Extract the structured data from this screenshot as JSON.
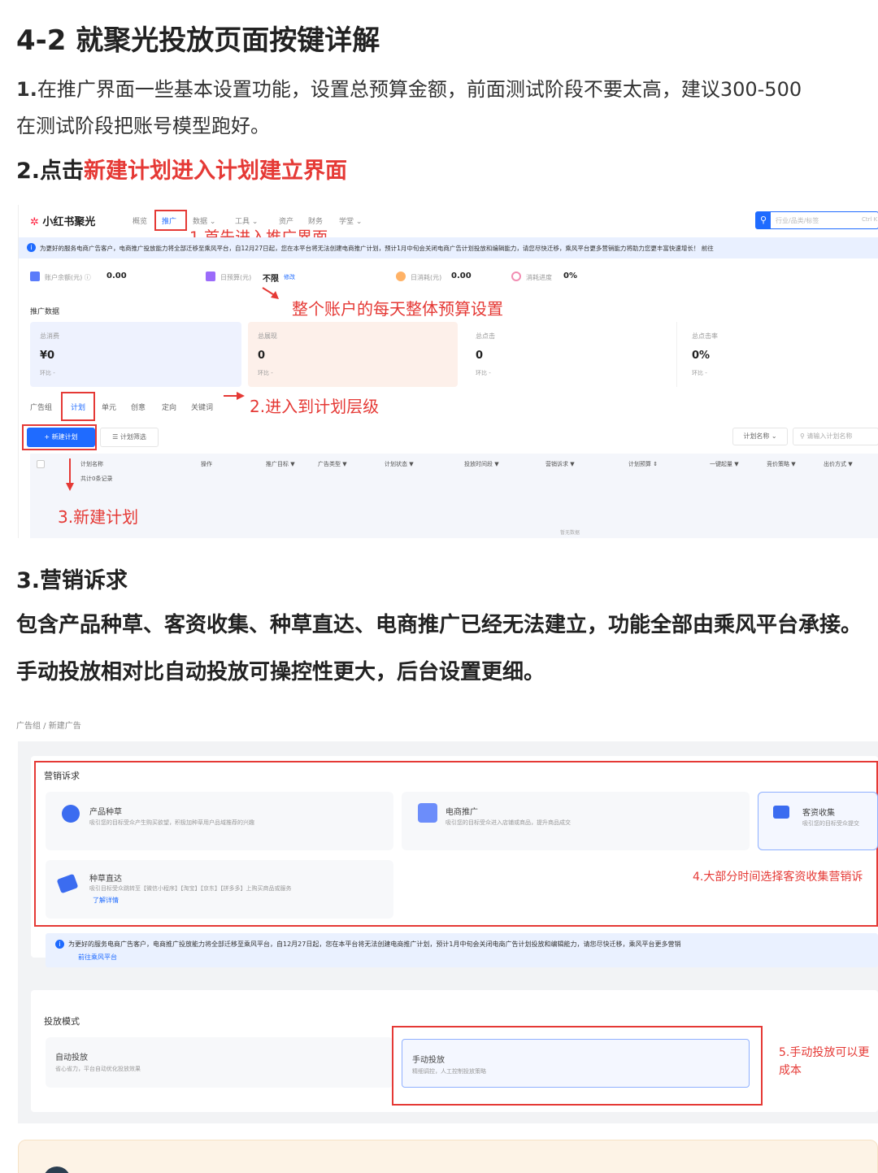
{
  "article": {
    "title": "4-2 就聚光投放页面按键详解",
    "p1_num": "1.",
    "p1_line1": "在推广界面一些基本设置功能，设置总预算金额，前面测试阶段不要太高，建议300-500",
    "p1_line2": "在测试阶段把账号模型跑好。",
    "s2_prefix": "2.点击",
    "s2_red": "新建计划进入计划建立界面",
    "s3_title": "3.营销诉求",
    "s3_red": "包含产品种草、客资收集、种草直达、电商推广已经无法建立，功能全部由乘风平台承接。",
    "s3_blue": "手动投放相对比自动投放可操控性更大，后台设置更细。"
  },
  "shot1": {
    "logo": "小红书聚光",
    "nav": [
      "概览",
      "推广",
      "数据 ⌄",
      "工具 ⌄",
      "资产",
      "财务",
      "学堂 ⌄"
    ],
    "search_placeholder": "行业/品类/标签",
    "search_shortcut": "Ctrl K",
    "notice": "为更好的服务电商广告客户，电商推广投放能力将全部迁移至乘风平台，自12月27日起，您在本平台将无法创建电商推广计划，预计1月中旬会关闭电商广告计划投放和编辑能力，请您尽快迁移，乘风平台更多营销能力将助力您更丰富快速增长！ 前往",
    "stats": [
      {
        "label": "账户余额(元) ⓘ",
        "value": "0.00"
      },
      {
        "label": "日预算(元)",
        "value": "不限",
        "link": "修改"
      },
      {
        "label": "日消耗(元)",
        "value": "0.00"
      },
      {
        "label": "消耗进度",
        "value": "0%"
      }
    ],
    "section": "推广数据",
    "cards": [
      {
        "label": "总消费",
        "value": "¥0",
        "sub": "环比 -"
      },
      {
        "label": "总展现",
        "value": "0",
        "sub": "环比 -"
      },
      {
        "label": "总点击",
        "value": "0",
        "sub": "环比 -"
      },
      {
        "label": "总点击率",
        "value": "0%",
        "sub": "环比 -"
      }
    ],
    "tabs": [
      "广告组",
      "计划",
      "单元",
      "创意",
      "定向",
      "关键词"
    ],
    "new_plan": "+ 新建计划",
    "filter": "☰ 计划筛选",
    "plan_name_select": "计划名称 ⌄",
    "plan_search": "请输入计划名称",
    "columns": [
      "计划名称",
      "操作",
      "推广目标 ▼",
      "广告类型 ▼",
      "计划状态 ▼",
      "投放时间段 ▼",
      "营销诉求 ▼",
      "计划预算 ⇕",
      "一键起量 ▼",
      "竞价策略 ▼",
      "出价方式 ▼"
    ],
    "row_sub": "共计0条记录",
    "empty": "暂无数据",
    "ann1": "1.首先进入推广界面",
    "ann2": "整个账户的每天整体预算设置",
    "ann3": "2.进入到计划层级",
    "ann4": "3.新建计划"
  },
  "shot2": {
    "breadcrumb": "广告组 / 新建广告",
    "marketing_title": "营销诉求",
    "options": [
      {
        "title": "产品种草",
        "desc": "吸引您的目标受众产生购买欲望，积极加种草用户品域推荐的兴趣"
      },
      {
        "title": "电商推广",
        "desc": "吸引您的目标受众进入店铺或商品，提升商品成交"
      },
      {
        "title": "客资收集",
        "desc": "吸引您的目标受众提交"
      },
      {
        "title": "种草直达",
        "desc": "吸引目标受众跳转至【微信小程序】【淘宝】【京东】【拼多多】上购买商品或服务",
        "link": "了解详情"
      }
    ],
    "ann5": "4.大部分时间选择客资收集营销诉",
    "notice": "为更好的服务电商广告客户，电商推广投放能力将全部迁移至乘风平台，自12月27日起，您在本平台将无法创建电商推广计划，预计1月中旬会关闭电商广告计划投放和编辑能力，请您尽快迁移，乘风平台更多营销",
    "notice_link": "前往乘风平台",
    "mode_title": "投放模式",
    "modes": [
      {
        "title": "自动投放",
        "desc": "省心省力，平台自动优化投放效果"
      },
      {
        "title": "手动投放",
        "desc": "精细调控，人工控制投放策略"
      }
    ],
    "ann6_l1": "5.手动投放可以更",
    "ann6_l2": "成本"
  },
  "colors": {
    "red": "#e53935",
    "blue": "#1e5fd6",
    "brand_blue": "#1f6bff"
  }
}
